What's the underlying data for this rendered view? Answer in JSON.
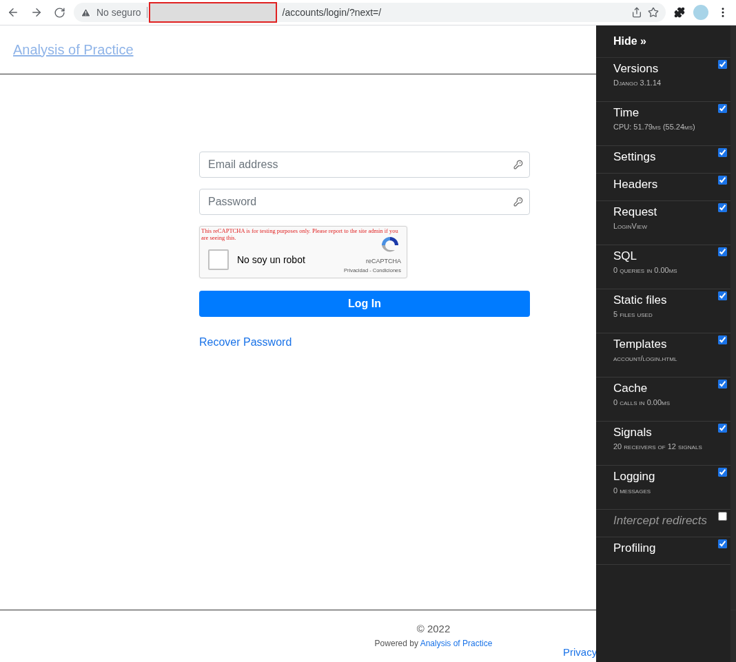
{
  "browser": {
    "security_label": "No seguro",
    "path": "/accounts/login/?next=/"
  },
  "header": {
    "site_title": "Analysis of Practice"
  },
  "login": {
    "email_placeholder": "Email address",
    "password_placeholder": "Password",
    "captcha": {
      "warning": "This reCAPTCHA is for testing purposes only. Please report to the site admin if you are seeing this.",
      "label": "No soy un robot",
      "checked": false,
      "brand": "reCAPTCHA",
      "links": "Privacidad - Condiciones"
    },
    "submit": "Log In",
    "recover_link": "Recover Password"
  },
  "footer": {
    "copyright": "© 2022",
    "powered_prefix": "Powered by",
    "powered_link": "Analysis of Practice",
    "privacy_link": "Privacy"
  },
  "debug_toolbar": {
    "hide": "Hide »",
    "panels": [
      {
        "title": "Versions",
        "subtitle": "Django 3.1.14",
        "checked": true
      },
      {
        "title": "Time",
        "subtitle": "CPU: 51.79ms (55.24ms)",
        "checked": true
      },
      {
        "title": "Settings",
        "checked": true
      },
      {
        "title": "Headers",
        "checked": true
      },
      {
        "title": "Request",
        "subtitle": "LoginView",
        "checked": true
      },
      {
        "title": "SQL",
        "subtitle": "0 queries in 0.00ms",
        "checked": true
      },
      {
        "title": "Static files",
        "subtitle": "5 files used",
        "checked": true
      },
      {
        "title": "Templates",
        "subtitle": "account/login.html",
        "checked": true
      },
      {
        "title": "Cache",
        "subtitle": "0 calls in 0.00ms",
        "checked": true
      },
      {
        "title": "Signals",
        "subtitle": "20 receivers of 12 signals",
        "checked": true
      },
      {
        "title": "Logging",
        "subtitle": "0 messages",
        "checked": true
      },
      {
        "title": "Intercept redirects",
        "checked": false
      },
      {
        "title": "Profiling",
        "checked": true
      }
    ]
  }
}
